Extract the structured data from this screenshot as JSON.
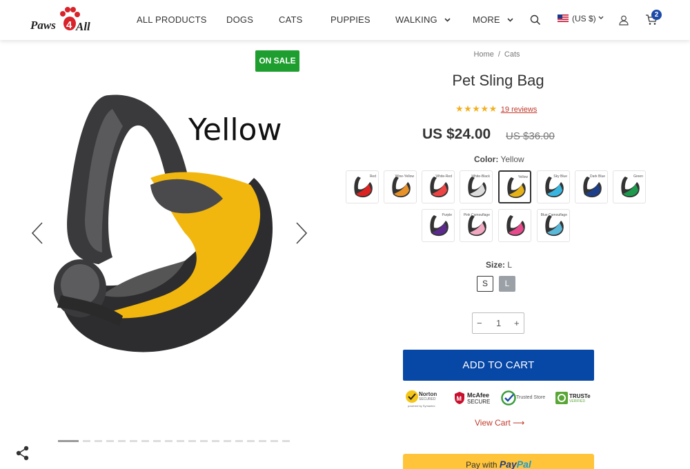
{
  "header": {
    "logo_text": "Paws4All",
    "nav": [
      "ALL PRODUCTS",
      "DOGS",
      "CATS",
      "PUPPIES",
      "WALKING",
      "MORE"
    ],
    "currency": "(US $)",
    "cart_count": "2",
    "icons": [
      "search-icon",
      "flag-us-icon",
      "user-icon",
      "cart-icon"
    ]
  },
  "gallery": {
    "badge": "ON SALE",
    "image_caption": "Yellow",
    "slide_count": 19,
    "active_slide": 1
  },
  "product": {
    "breadcrumb": [
      "Home",
      "Cats"
    ],
    "title": "Pet Sling Bag",
    "rating": 5,
    "reviews": "19 reviews",
    "price": "US $24.00",
    "old_price": "US $36.00",
    "color_label": "Color:",
    "color_value": "Yellow",
    "swatches": [
      {
        "name": "Red",
        "color": "#d22"
      },
      {
        "name": "Wine-Yellow",
        "color": "#e8922a"
      },
      {
        "name": "White-Red",
        "color": "#e44"
      },
      {
        "name": "White-Black",
        "color": "#ddd"
      },
      {
        "name": "Yellow",
        "color": "#e6b21a",
        "selected": true
      },
      {
        "name": "Sky Blue",
        "color": "#39b6e0"
      },
      {
        "name": "Dark Blue",
        "color": "#1d3e8a"
      },
      {
        "name": "Green",
        "color": "#1d9a4e"
      },
      {
        "name": "Purple",
        "color": "#5b2a8c"
      },
      {
        "name": "Pink Camouflage",
        "color": "#f2a8c0"
      },
      {
        "name": "",
        "color": "#e64a8a"
      },
      {
        "name": "Blue Camouflage",
        "color": "#5ab8d8"
      }
    ],
    "size_label": "Size:",
    "size_value": "L",
    "sizes": [
      "S",
      "L"
    ],
    "quantity": "1",
    "qty_minus": "−",
    "qty_plus": "+",
    "add_to_cart": "ADD TO CART",
    "trust_badges": [
      {
        "name": "Norton",
        "line1": "Norton",
        "line2": "SECURED",
        "line3": "powered by Symantec"
      },
      {
        "name": "McAfee",
        "line1": "McAfee",
        "line2": "SECURE"
      },
      {
        "name": "Trusted Store",
        "line1": "Trusted Store"
      },
      {
        "name": "TRUSTe",
        "line1": "TRUSTe",
        "line2": "VERIFIED"
      }
    ],
    "view_cart": "View Cart ⟶",
    "paypal_prefix": "Pay with",
    "paypal_brand_1": "Pay",
    "paypal_brand_2": "Pal"
  },
  "colors": {
    "accent_blue": "#0747a6",
    "sale_green": "#1e9e2e",
    "link_red": "#c0392b",
    "star_gold": "#f2b01e",
    "paypal_yellow": "#ffc439"
  }
}
